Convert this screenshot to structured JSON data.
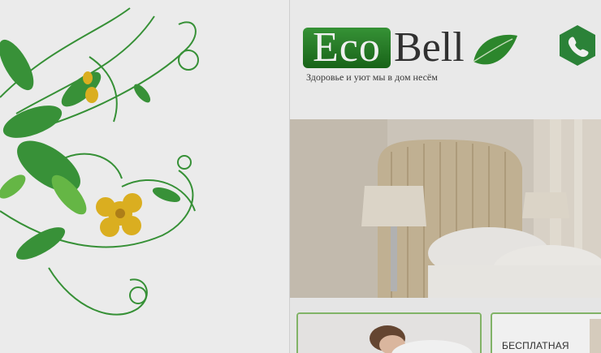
{
  "logo": {
    "word_eco": "Eco",
    "word_bell": "Bell",
    "tagline": "Здоровье и уют мы в дом несём"
  },
  "header": {
    "phone_icon": "phone-icon"
  },
  "promo_cards": [
    {
      "label": ""
    },
    {
      "label": "БЕСПЛАТНАЯ"
    }
  ],
  "colors": {
    "brand_green": "#2f8f2f",
    "accent_yellow": "#e8b923",
    "card_border": "#8abf6e"
  }
}
